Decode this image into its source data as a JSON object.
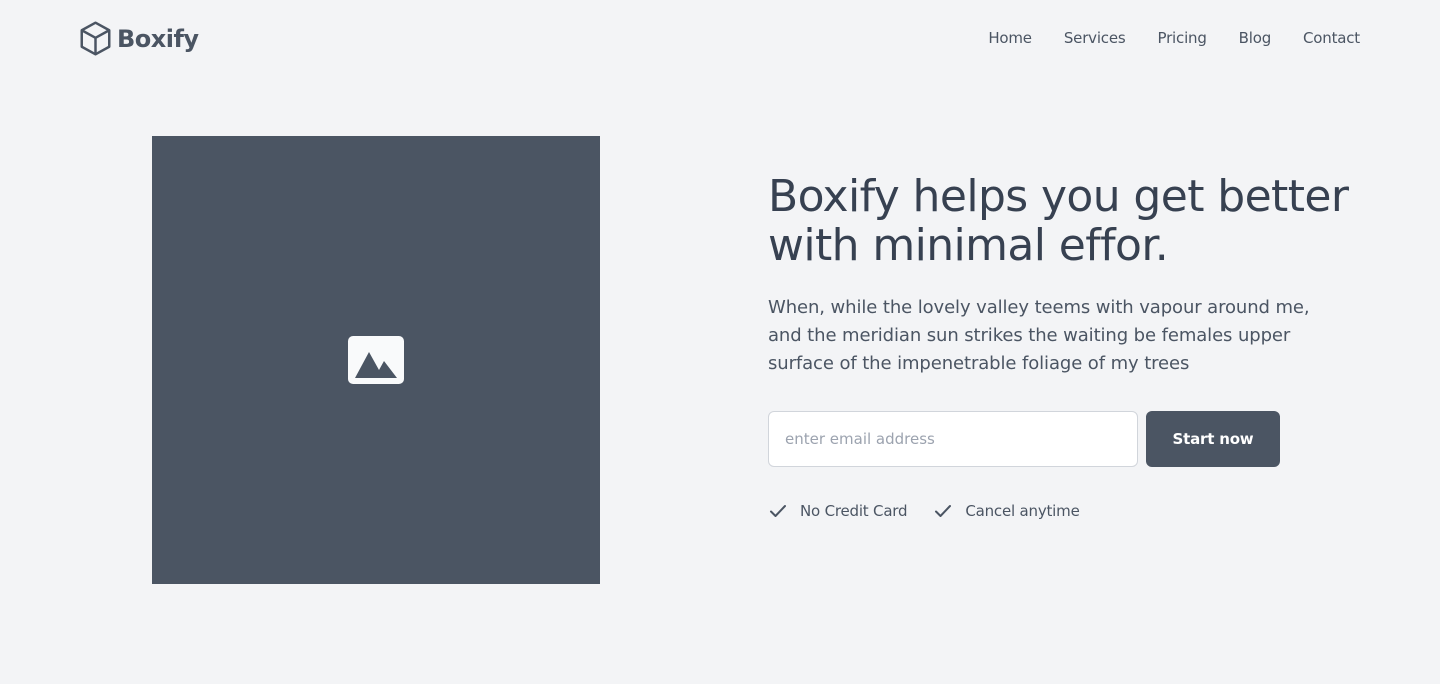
{
  "brand": {
    "name": "Boxify",
    "logo_icon": "cube-icon",
    "color": "#4b5563"
  },
  "nav": {
    "items": [
      {
        "label": "Home"
      },
      {
        "label": "Services"
      },
      {
        "label": "Pricing"
      },
      {
        "label": "Blog"
      },
      {
        "label": "Contact"
      }
    ]
  },
  "hero": {
    "image_icon": "image-placeholder-icon",
    "image_bg": "#4b5563",
    "headline": "Boxify helps you get better with minimal effor.",
    "subtext": "When, while the lovely valley teems with vapour around me, and the meridian sun strikes the waiting be females upper surface of the impenetrable foliage of my trees",
    "email": {
      "value": "",
      "placeholder": "enter email address"
    },
    "cta_label": "Start now",
    "perks": [
      {
        "icon": "check-icon",
        "label": "No Credit Card"
      },
      {
        "icon": "check-icon",
        "label": "Cancel anytime"
      }
    ]
  },
  "colors": {
    "background": "#f3f4f6",
    "text": "#374151",
    "accent": "#4b5563"
  }
}
